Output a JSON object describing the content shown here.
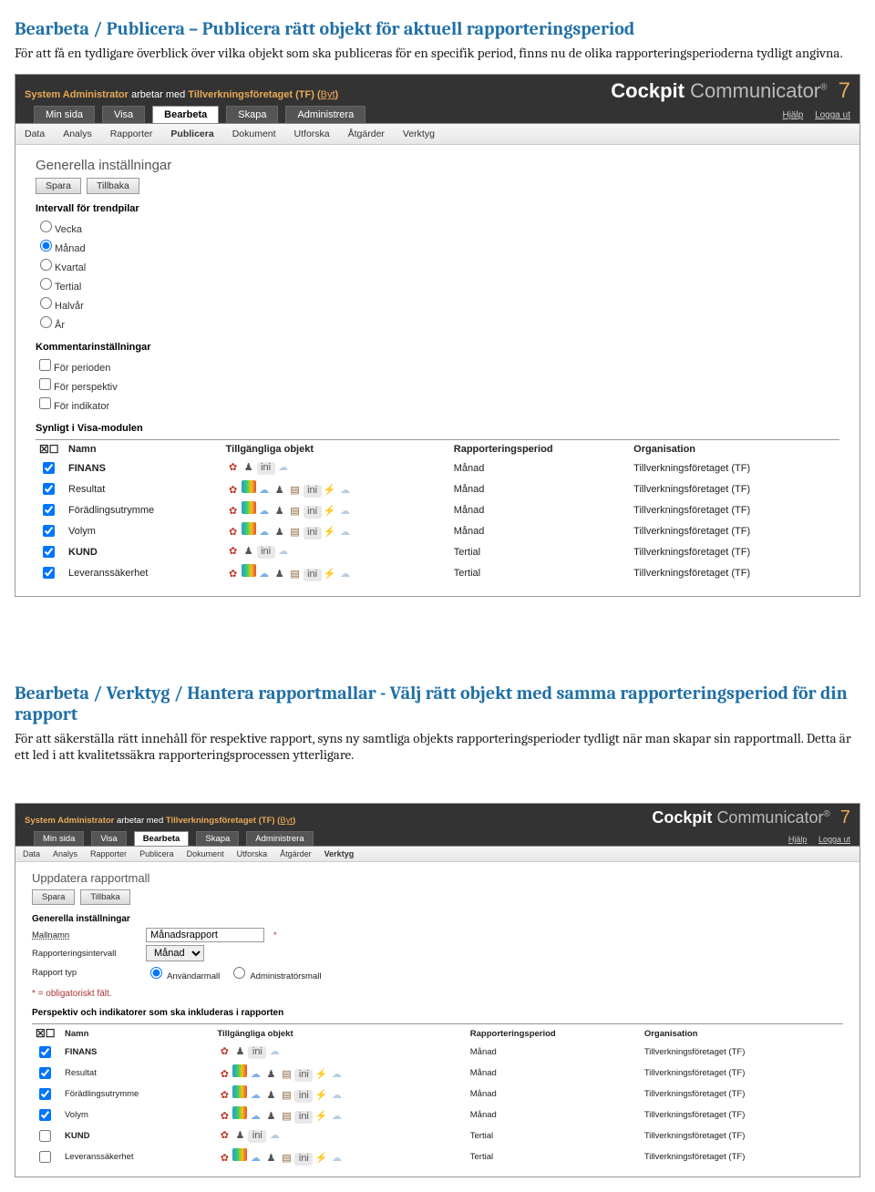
{
  "doc": {
    "section1_title": "Bearbeta / Publicera – Publicera rätt objekt för aktuell rapporteringsperiod",
    "section1_body": "För att få en tydligare överblick över vilka objekt som ska publiceras för en specifik period, finns nu de olika rapporteringsperioderna tydligt angivna.",
    "section2_title": "Bearbeta / Verktyg / Hantera rapportmallar -  Välj rätt objekt med samma rapporteringsperiod för din rapport",
    "section2_body": "För att säkerställa rätt innehåll för respektive rapport, syns ny samtliga objekts rapporteringsperioder tydligt när man skapar sin rapportmall. Detta är ett led i att kvalitetssäkra rapporteringsprocessen ytterligare."
  },
  "common": {
    "user_label": "System Administrator",
    "works_with": "arbetar med",
    "org": "Tillverkningsföretaget (TF)",
    "byt": "Byt",
    "brand_a": "Cockpit",
    "brand_b": "Communicator",
    "brand_reg": "®",
    "brand_ver": "7",
    "help": "Hjälp",
    "logout": "Logga ut",
    "main_tabs": [
      "Min sida",
      "Visa",
      "Bearbeta",
      "Skapa",
      "Administrera"
    ],
    "sub_tabs": [
      "Data",
      "Analys",
      "Rapporter",
      "Publicera",
      "Dokument",
      "Utforska",
      "Åtgärder",
      "Verktyg"
    ],
    "btn_save": "Spara",
    "btn_back": "Tillbaka",
    "col_name": "Namn",
    "col_objects": "Tillgängliga objekt",
    "col_period": "Rapporteringsperiod",
    "col_org": "Organisation",
    "org_full": "Tillverkningsföretaget (TF)"
  },
  "app1": {
    "panel_title": "Generella inställningar",
    "interval_hd": "Intervall för trendpilar",
    "interval_opts": [
      "Vecka",
      "Månad",
      "Kvartal",
      "Tertial",
      "Halvår",
      "År"
    ],
    "interval_selected": "Månad",
    "comment_hd": "Kommentarinställningar",
    "comment_opts": [
      "För perioden",
      "För perspektiv",
      "För indikator"
    ],
    "visible_hd": "Synligt i Visa-modulen",
    "hdr_icons": "☒☐",
    "rows": [
      {
        "chk": true,
        "name": "FINANS",
        "indent": 0,
        "bold": true,
        "icons": "few",
        "period": "Månad"
      },
      {
        "chk": true,
        "name": "Resultat",
        "indent": 1,
        "bold": false,
        "icons": "many",
        "period": "Månad"
      },
      {
        "chk": true,
        "name": "Förädlingsutrymme",
        "indent": 1,
        "bold": false,
        "icons": "many",
        "period": "Månad"
      },
      {
        "chk": true,
        "name": "Volym",
        "indent": 1,
        "bold": false,
        "icons": "many",
        "period": "Månad"
      },
      {
        "chk": true,
        "name": "KUND",
        "indent": 0,
        "bold": true,
        "icons": "few",
        "period": "Tertial"
      },
      {
        "chk": true,
        "name": "Leveranssäkerhet",
        "indent": 1,
        "bold": false,
        "icons": "many",
        "period": "Tertial"
      }
    ]
  },
  "app2": {
    "panel_title": "Uppdatera rapportmall",
    "gen_hd": "Generella inställningar",
    "fld_name_lbl": "Mallnamn",
    "fld_name_val": "Månadsrapport",
    "fld_interval_lbl": "Rapporteringsintervall",
    "fld_interval_val": "Månad",
    "fld_type_lbl": "Rapport typ",
    "fld_type_opt1": "Användarmall",
    "fld_type_opt2": "Administratörsmall",
    "req_note": "* = obligatoriskt fält.",
    "persp_hd": "Perspektiv och indikatorer som ska inkluderas i rapporten",
    "hdr_icons": "☒☐",
    "rows": [
      {
        "chk": true,
        "name": "FINANS",
        "indent": 0,
        "bold": true,
        "icons": "few2",
        "period": "Månad"
      },
      {
        "chk": true,
        "name": "Resultat",
        "indent": 1,
        "bold": false,
        "icons": "many2",
        "period": "Månad"
      },
      {
        "chk": true,
        "name": "Förädlingsutrymme",
        "indent": 1,
        "bold": false,
        "icons": "many2",
        "period": "Månad"
      },
      {
        "chk": true,
        "name": "Volym",
        "indent": 1,
        "bold": false,
        "icons": "many2",
        "period": "Månad"
      },
      {
        "chk": false,
        "name": "KUND",
        "indent": 0,
        "bold": true,
        "icons": "few2",
        "period": "Tertial"
      },
      {
        "chk": false,
        "name": "Leveranssäkerhet",
        "indent": 1,
        "bold": false,
        "icons": "many2",
        "period": "Tertial"
      }
    ]
  }
}
